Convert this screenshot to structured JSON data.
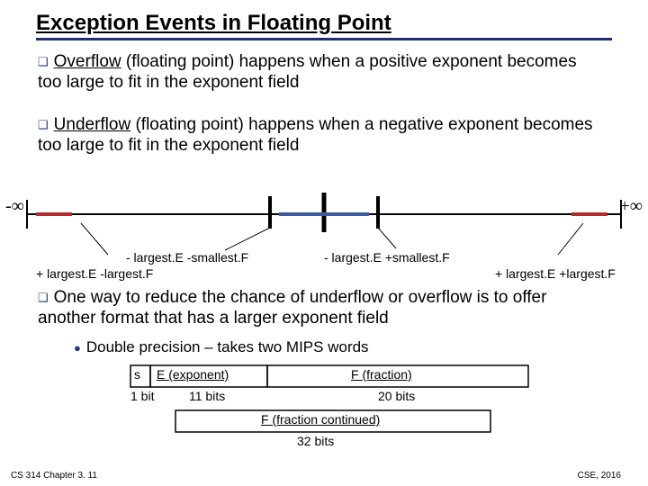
{
  "title": "Exception Events in Floating Point",
  "bullets": {
    "overflow_lead": "Overflow",
    "overflow_rest": " (floating point) happens when a positive exponent becomes too large to fit in the exponent field",
    "underflow_lead": "Underflow",
    "underflow_rest": " (floating point) happens when a negative exponent becomes too large to fit in the exponent field",
    "reduce": "One way to reduce the chance of underflow or overflow is to offer another format that has a larger exponent field",
    "double": "Double precision – takes two MIPS words"
  },
  "numberline": {
    "neg_inf": "-∞",
    "pos_inf": "+∞",
    "labels": {
      "neg_large": "+ largest.E -largest.F",
      "neg_small": "- largest.E -smallest.F",
      "pos_small": "- largest.E +smallest.F",
      "pos_large": "+ largest.E +largest.F"
    }
  },
  "format": {
    "s": "s",
    "e": "E (exponent)",
    "f1": "F (fraction)",
    "f2": "F (fraction continued)",
    "w_s": "1 bit",
    "w_e": "11 bits",
    "w_f1": "20 bits",
    "w_f2": "32 bits"
  },
  "footer": {
    "left": "CS 314 Chapter 3. 11",
    "right": "CSE, 2016"
  }
}
